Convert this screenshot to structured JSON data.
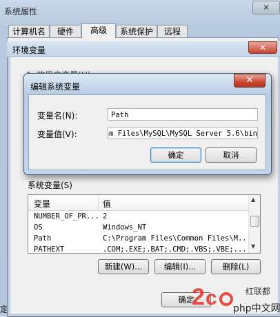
{
  "system_properties": {
    "title": "系统属性",
    "tabs": [
      "计算机名",
      "硬件",
      "高级",
      "系统保护",
      "远程"
    ],
    "selected_tab": "高级",
    "bottom_left_partial": "定"
  },
  "env_dialog": {
    "title": "环境变量",
    "user_vars_label": "1. 的用户变量(U)",
    "system_vars_label": "系统变量(S)",
    "columns": [
      "变量",
      "值"
    ],
    "rows": [
      [
        "NUMBER_OF_PR...",
        "2"
      ],
      [
        "OS",
        "Windows_NT"
      ],
      [
        "Path",
        "C:\\Program Files\\Common Files\\M..."
      ],
      [
        "PATHEXT",
        ".COM;.EXE;.BAT;.CMD;.VBS;.VBE;..."
      ]
    ],
    "buttons": {
      "new": "新建(W)...",
      "edit": "编辑(I)...",
      "delete": "删除(L)"
    },
    "ok": "确定",
    "partial_text": "红联都"
  },
  "edit_dialog": {
    "title": "编辑系统变量",
    "name_label": "变量名(N):",
    "name_value": "Path",
    "value_label": "变量值(V):",
    "value_value": "am Files\\MySQL\\MySQL Server 5.6\\bin",
    "ok": "确定",
    "cancel": "取消"
  },
  "watermark": {
    "text": "php中文网"
  }
}
